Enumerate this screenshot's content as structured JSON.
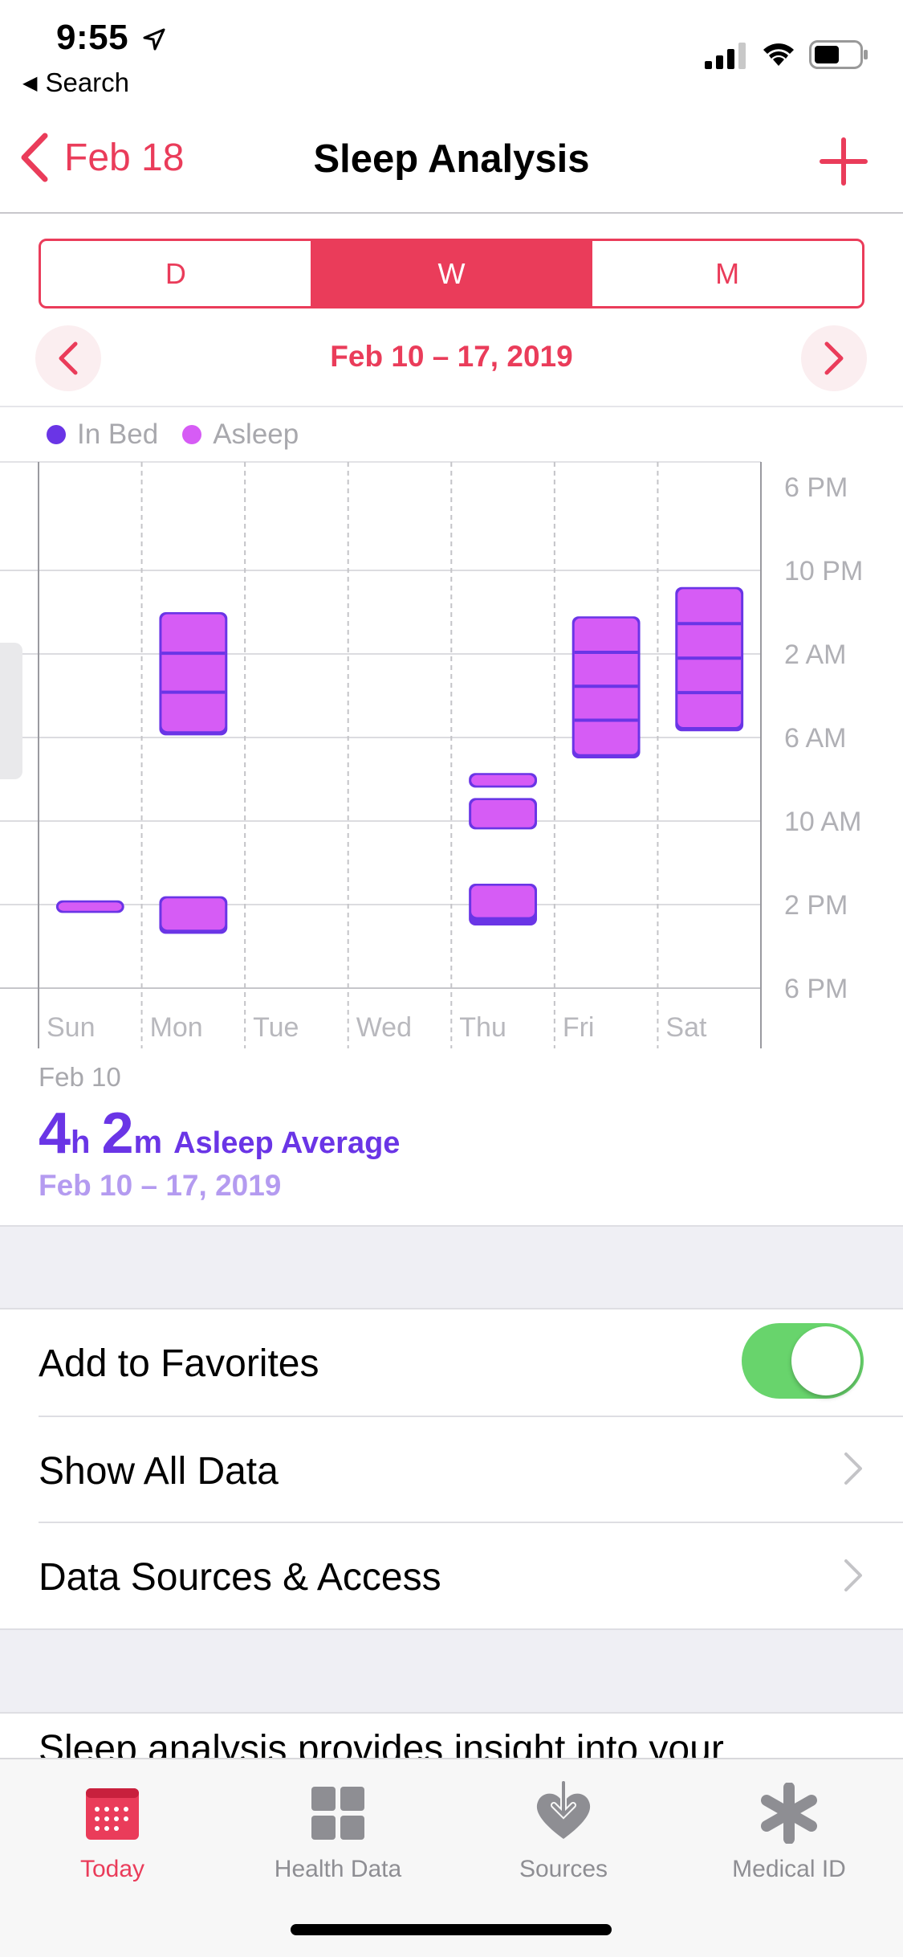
{
  "status_bar": {
    "time": "9:55",
    "back_app": "Search"
  },
  "nav": {
    "back_label": "Feb 18",
    "title": "Sleep Analysis"
  },
  "segmented": {
    "options": [
      "D",
      "W",
      "M"
    ],
    "selected": "W"
  },
  "date_range": "Feb 10 – 17, 2019",
  "legend": [
    {
      "label": "In Bed",
      "color": "#6a35e6"
    },
    {
      "label": "Asleep",
      "color": "#d65cf5"
    }
  ],
  "chart_data": {
    "type": "bar",
    "subtype": "floating-range",
    "categories": [
      "Sun",
      "Mon",
      "Tue",
      "Wed",
      "Thu",
      "Fri",
      "Sat"
    ],
    "y_tick_labels": [
      "6 PM",
      "10 PM",
      "2 AM",
      "6 AM",
      "10 AM",
      "2 PM",
      "6 PM"
    ],
    "y_range_hours": [
      0,
      24
    ],
    "series": [
      {
        "name": "In Bed",
        "color": "#6a35e6",
        "ranges": [
          [
            [
              19.8,
              20.4
            ]
          ],
          [
            [
              6.0,
              11.9
            ],
            [
              19.6,
              21.4
            ]
          ],
          [],
          [],
          [
            [
              13.7,
              14.4
            ],
            [
              14.9,
              16.4
            ],
            [
              19.0,
              21.0
            ]
          ],
          [
            [
              6.2,
              13.0
            ]
          ],
          [
            [
              4.8,
              11.7
            ]
          ]
        ]
      },
      {
        "name": "Asleep",
        "color": "#d65cf5",
        "ranges": [
          [
            [
              19.9,
              20.3
            ]
          ],
          [
            [
              6.1,
              11.7
            ],
            [
              19.7,
              21.2
            ]
          ],
          [],
          [],
          [
            [
              13.8,
              14.3
            ],
            [
              15.0,
              16.3
            ],
            [
              19.1,
              20.6
            ]
          ],
          [
            [
              6.3,
              12.8
            ]
          ],
          [
            [
              4.9,
              11.5
            ]
          ]
        ]
      }
    ],
    "grid": true
  },
  "summary": {
    "selected_date": "Feb 10",
    "hours": "4",
    "hours_unit": "h",
    "minutes": "2",
    "minutes_unit": "m",
    "label": "Asleep Average",
    "range": "Feb 10 – 17, 2019"
  },
  "list": {
    "favorites_label": "Add to Favorites",
    "favorites_on": true,
    "show_all_label": "Show All Data",
    "sources_label": "Data Sources & Access"
  },
  "description": "Sleep analysis provides insight into your",
  "tabbar": [
    {
      "label": "Today",
      "icon": "calendar-icon",
      "active": true
    },
    {
      "label": "Health Data",
      "icon": "grid-icon",
      "active": false
    },
    {
      "label": "Sources",
      "icon": "heart-arrow-icon",
      "active": false
    },
    {
      "label": "Medical ID",
      "icon": "asterisk-icon",
      "active": false
    }
  ],
  "colors": {
    "accent": "#ea3c5a",
    "in_bed": "#6a35e6",
    "asleep": "#d65cf5",
    "toggle_on": "#68d46c"
  }
}
